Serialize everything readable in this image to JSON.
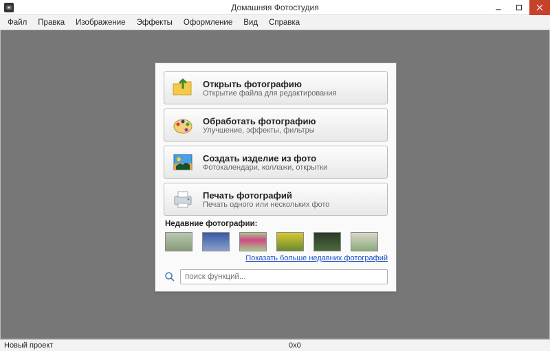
{
  "window": {
    "title": "Домашняя Фотостудия"
  },
  "menu": {
    "file": "Файл",
    "edit": "Правка",
    "image": "Изображение",
    "effects": "Эффекты",
    "design": "Оформление",
    "view": "Вид",
    "help": "Справка"
  },
  "actions": {
    "open": {
      "title": "Открыть фотографию",
      "sub": "Открытие файла для редактирования"
    },
    "process": {
      "title": "Обработать фотографию",
      "sub": "Улучшение, эффекты, фильтры"
    },
    "create": {
      "title": "Создать изделие из фото",
      "sub": "Фотокалендари, коллажи, открытки"
    },
    "print": {
      "title": "Печать фотографий",
      "sub": "Печать одного или нескольких фото"
    }
  },
  "recent": {
    "label": "Недавние фотографии:",
    "more": "Показать больше недавних фотографий"
  },
  "search": {
    "placeholder": "поиск функций..."
  },
  "status": {
    "project": "Новый проект",
    "dims": "0x0"
  }
}
